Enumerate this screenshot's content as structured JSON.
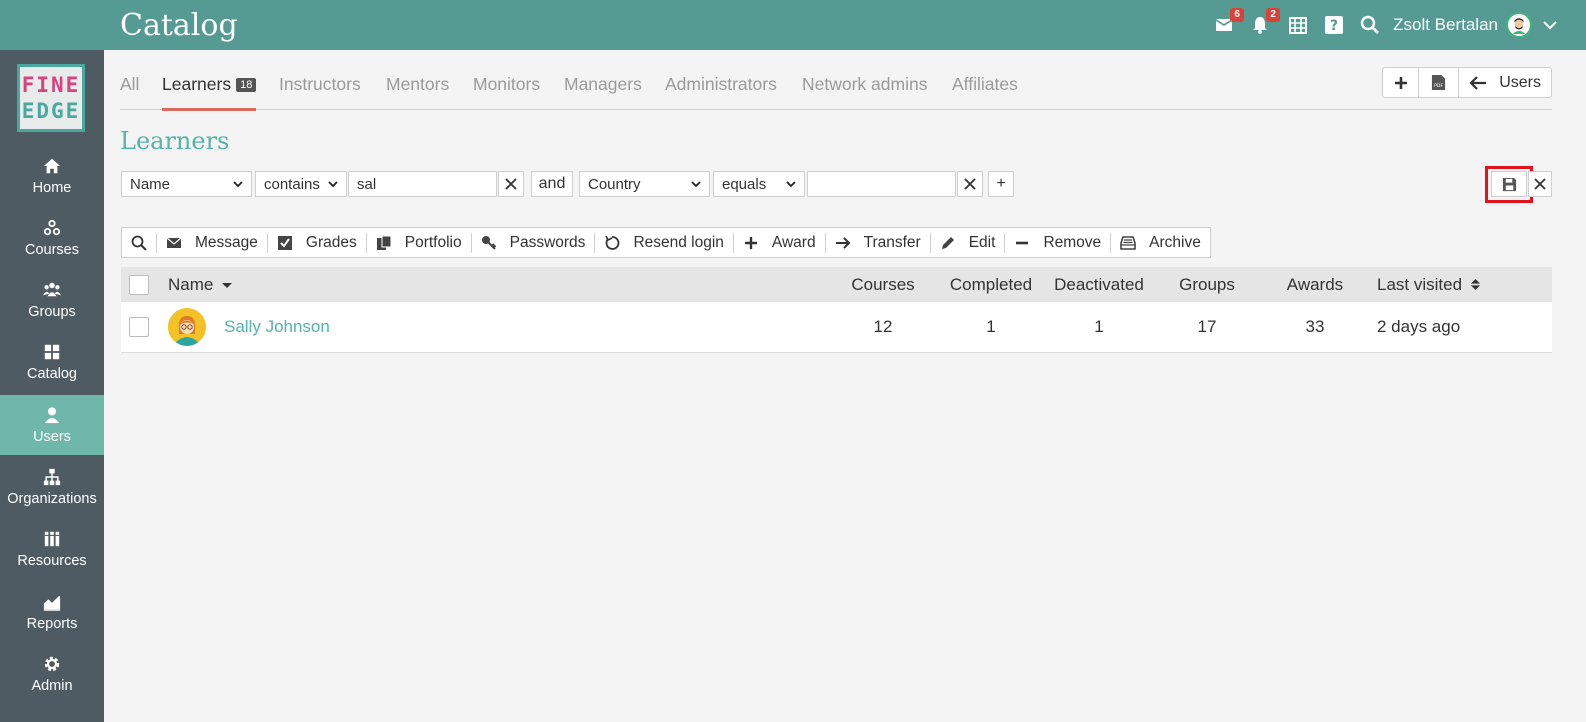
{
  "app": {
    "title": "Catalog"
  },
  "header": {
    "mail_count": "6",
    "notif_count": "2",
    "user_name": "Zsolt Bertalan"
  },
  "logo": {
    "line1": "FINE",
    "line2": "EDGE"
  },
  "sidebar": {
    "items": [
      {
        "label": "Home",
        "icon": "home-icon"
      },
      {
        "label": "Courses",
        "icon": "courses-icon"
      },
      {
        "label": "Groups",
        "icon": "groups-icon"
      },
      {
        "label": "Catalog",
        "icon": "catalog-icon"
      },
      {
        "label": "Users",
        "icon": "user-icon",
        "active": true
      },
      {
        "label": "Organizations",
        "icon": "org-icon"
      },
      {
        "label": "Resources",
        "icon": "resources-icon"
      },
      {
        "label": "Reports",
        "icon": "reports-icon"
      },
      {
        "label": "Admin",
        "icon": "gear-icon"
      }
    ]
  },
  "tabs": [
    {
      "label": "All"
    },
    {
      "label": "Learners",
      "count": "18",
      "active": true
    },
    {
      "label": "Instructors"
    },
    {
      "label": "Mentors"
    },
    {
      "label": "Monitors"
    },
    {
      "label": "Managers"
    },
    {
      "label": "Administrators"
    },
    {
      "label": "Network admins"
    },
    {
      "label": "Affiliates"
    }
  ],
  "top_actions": {
    "users_label": "Users"
  },
  "page": {
    "title": "Learners"
  },
  "filter": {
    "field1": "Name",
    "op1": "contains",
    "value1": "sal",
    "joiner": "and",
    "field2": "Country",
    "op2": "equals",
    "value2": "",
    "add_label": "+"
  },
  "toolbar": {
    "message": "Message",
    "grades": "Grades",
    "portfolio": "Portfolio",
    "passwords": "Passwords",
    "resend_login": "Resend login",
    "award": "Award",
    "transfer": "Transfer",
    "edit": "Edit",
    "remove": "Remove",
    "archive": "Archive"
  },
  "table": {
    "columns": {
      "name": "Name",
      "courses": "Courses",
      "completed": "Completed",
      "deactivated": "Deactivated",
      "groups": "Groups",
      "awards": "Awards",
      "last_visited": "Last visited"
    },
    "rows": [
      {
        "name": "Sally Johnson",
        "courses": "12",
        "completed": "1",
        "deactivated": "1",
        "groups": "17",
        "awards": "33",
        "last_visited": "2 days ago"
      }
    ]
  },
  "colors": {
    "header": "#559b93",
    "sidebar": "#4f5b62",
    "sidebar_active": "#6fb6ab",
    "accent": "#55b3a9",
    "tab_underline": "#d96a5c",
    "highlight": "#e0121c"
  }
}
